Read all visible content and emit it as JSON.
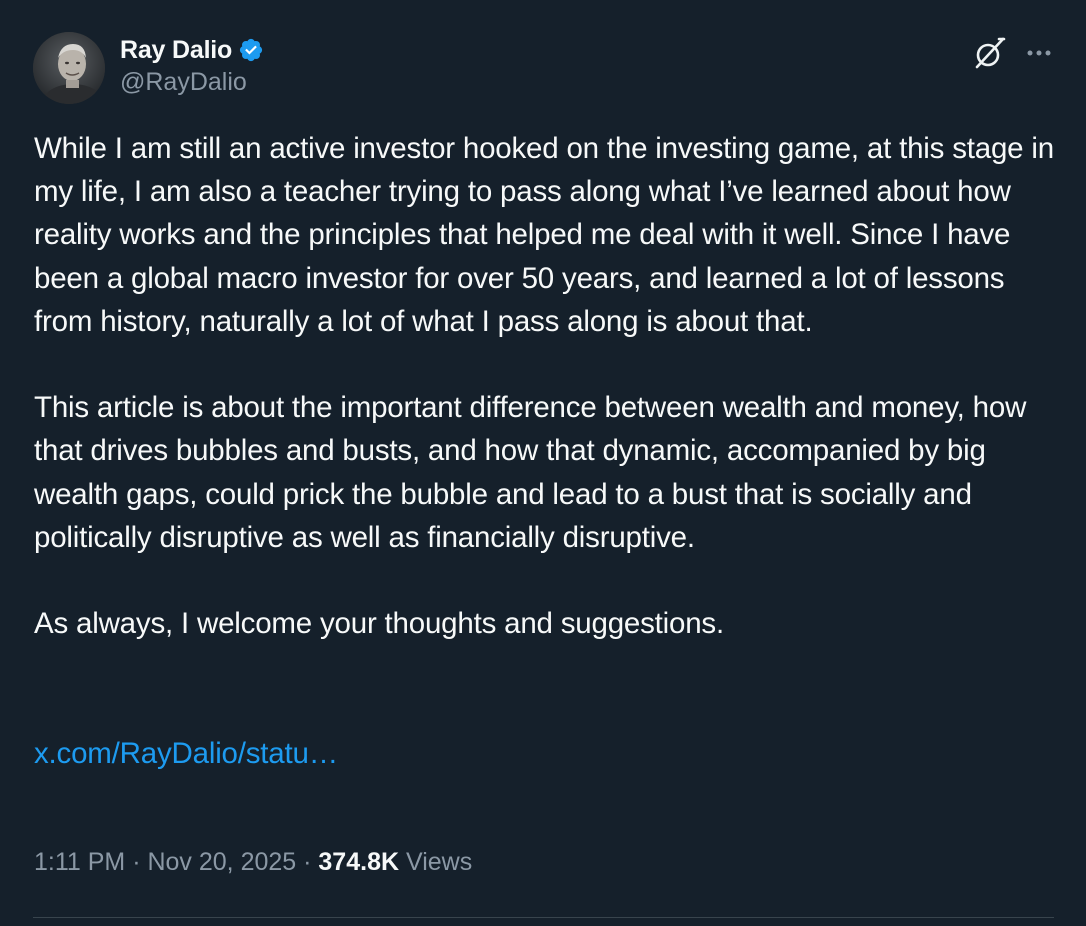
{
  "author": {
    "display_name": "Ray Dalio",
    "handle": "@RayDalio",
    "verified": true,
    "avatar_icon": "profile-photo"
  },
  "header_actions": {
    "grok_icon": "grok-icon",
    "more_icon": "more-icon"
  },
  "tweet": {
    "paragraphs": [
      "While I am still an active investor hooked on the investing game, at this stage in my life, I am also a teacher trying to pass along what I’ve learned about how reality works and the principles that helped me deal with it well. Since I have been a global macro investor for over 50 years, and learned a lot of lessons from history, naturally a lot of what I pass along is about that.",
      "This article is about the important difference between wealth and money, how that drives bubbles and busts, and how that dynamic, accompanied by big wealth gaps, could prick the bubble and lead to a bust that is socially and politically disruptive as well as financially disruptive.",
      "As always, I welcome your thoughts and suggestions."
    ],
    "link_text": "x.com/RayDalio/statu…"
  },
  "meta": {
    "time": "1:11 PM",
    "separator": " · ",
    "date": "Nov 20, 2025",
    "views_count": "374.8K",
    "views_label": " Views"
  },
  "colors": {
    "background": "#15202b",
    "text_primary": "#f7f9f9",
    "text_secondary": "#8b98a5",
    "link": "#1d9bf0",
    "verified_badge": "#1d9bf0",
    "divider": "#38444d"
  }
}
